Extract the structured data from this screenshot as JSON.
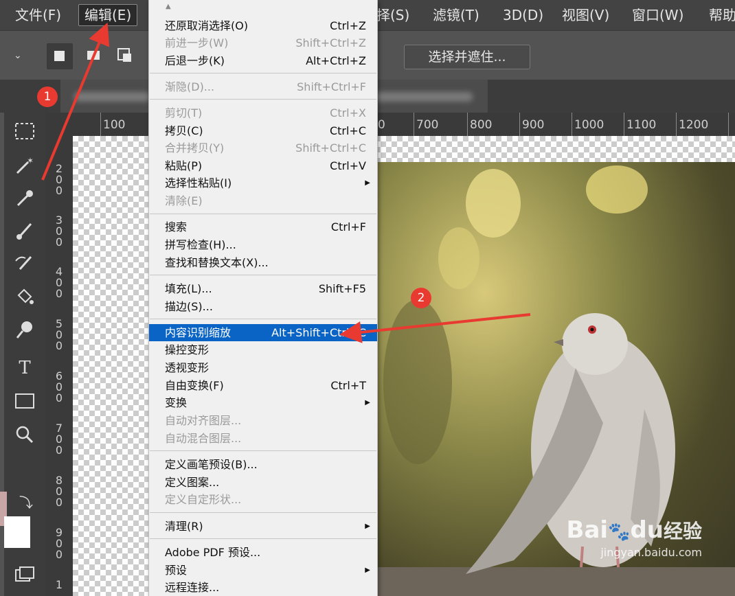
{
  "menubar": {
    "items": [
      {
        "label": "文件(F)"
      },
      {
        "label": "编辑(E)"
      },
      {
        "label": "择(S)"
      },
      {
        "label": "滤镜(T)"
      },
      {
        "label": "3D(D)"
      },
      {
        "label": "视图(V)"
      },
      {
        "label": "窗口(W)"
      },
      {
        "label": "帮助"
      }
    ]
  },
  "options_bar": {
    "select_and_mask": "选择并遮住..."
  },
  "rulers": {
    "top_ticks": [
      "100",
      "0",
      "700",
      "800",
      "900",
      "1000",
      "1100",
      "1200"
    ],
    "left_ticks": [
      [
        "2",
        "0",
        "0"
      ],
      [
        "3",
        "0",
        "0"
      ],
      [
        "4",
        "0",
        "0"
      ],
      [
        "5",
        "0",
        "0"
      ],
      [
        "6",
        "0",
        "0"
      ],
      [
        "7",
        "0",
        "0"
      ],
      [
        "8",
        "0",
        "0"
      ],
      [
        "9",
        "0",
        "0"
      ],
      [
        "1"
      ]
    ]
  },
  "edit_menu": {
    "items": [
      {
        "label": "还原取消选择(O)",
        "shortcut": "Ctrl+Z",
        "disabled": false
      },
      {
        "label": "前进一步(W)",
        "shortcut": "Shift+Ctrl+Z",
        "disabled": true
      },
      {
        "label": "后退一步(K)",
        "shortcut": "Alt+Ctrl+Z",
        "disabled": false
      },
      {
        "label": "渐隐(D)...",
        "shortcut": "Shift+Ctrl+F",
        "disabled": true
      },
      {
        "label": "剪切(T)",
        "shortcut": "Ctrl+X",
        "disabled": true
      },
      {
        "label": "拷贝(C)",
        "shortcut": "Ctrl+C",
        "disabled": false
      },
      {
        "label": "合并拷贝(Y)",
        "shortcut": "Shift+Ctrl+C",
        "disabled": true
      },
      {
        "label": "粘贴(P)",
        "shortcut": "Ctrl+V",
        "disabled": false
      },
      {
        "label": "选择性粘贴(I)",
        "shortcut": "",
        "disabled": false,
        "submenu": true
      },
      {
        "label": "清除(E)",
        "shortcut": "",
        "disabled": true
      },
      {
        "label": "搜索",
        "shortcut": "Ctrl+F",
        "disabled": false
      },
      {
        "label": "拼写检查(H)...",
        "shortcut": "",
        "disabled": false
      },
      {
        "label": "查找和替换文本(X)...",
        "shortcut": "",
        "disabled": false
      },
      {
        "label": "填充(L)...",
        "shortcut": "Shift+F5",
        "disabled": false
      },
      {
        "label": "描边(S)...",
        "shortcut": "",
        "disabled": false
      },
      {
        "label": "内容识别缩放",
        "shortcut": "Alt+Shift+Ctrl+C",
        "disabled": false,
        "highlighted": true
      },
      {
        "label": "操控变形",
        "shortcut": "",
        "disabled": false
      },
      {
        "label": "透视变形",
        "shortcut": "",
        "disabled": false
      },
      {
        "label": "自由变换(F)",
        "shortcut": "Ctrl+T",
        "disabled": false
      },
      {
        "label": "变换",
        "shortcut": "",
        "disabled": false,
        "submenu": true
      },
      {
        "label": "自动对齐图层...",
        "shortcut": "",
        "disabled": true
      },
      {
        "label": "自动混合图层...",
        "shortcut": "",
        "disabled": true
      },
      {
        "label": "定义画笔预设(B)...",
        "shortcut": "",
        "disabled": false
      },
      {
        "label": "定义图案...",
        "shortcut": "",
        "disabled": false
      },
      {
        "label": "定义自定形状...",
        "shortcut": "",
        "disabled": true
      },
      {
        "label": "清理(R)",
        "shortcut": "",
        "disabled": false,
        "submenu": true
      },
      {
        "label": "Adobe PDF 预设...",
        "shortcut": "",
        "disabled": false
      },
      {
        "label": "预设",
        "shortcut": "",
        "disabled": false,
        "submenu": true
      },
      {
        "label": "远程连接...",
        "shortcut": "",
        "disabled": false
      }
    ]
  },
  "annotations": {
    "step1": "1",
    "step2": "2"
  },
  "watermark": {
    "brand": "Bai",
    "brand2": "du",
    "cn": "经验",
    "url": "jingyan.baidu.com"
  },
  "colors": {
    "menu_highlight": "#0a64c6",
    "annotation_red": "#e83a30"
  },
  "icons": [
    "rect-marquee-icon",
    "magic-wand-icon",
    "eyedropper-icon",
    "brush-icon",
    "history-brush-icon",
    "paint-bucket-icon",
    "dodge-icon",
    "type-icon",
    "rectangle-shape-icon",
    "zoom-icon",
    "swap-colors-icon",
    "screen-mode-icon"
  ]
}
